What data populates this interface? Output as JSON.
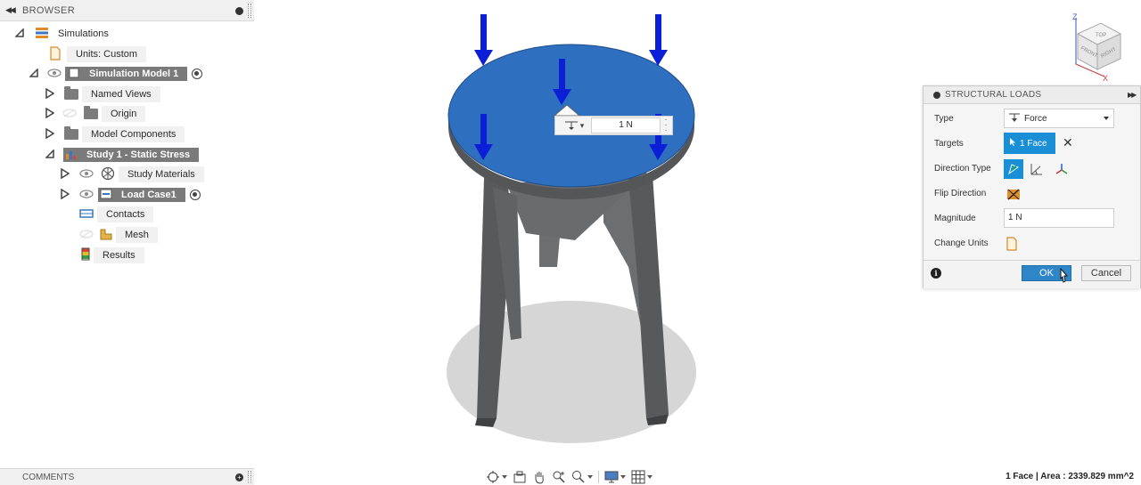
{
  "browser": {
    "title": "BROWSER",
    "tree": [
      {
        "label": "Simulations"
      },
      {
        "label": "Units: Custom"
      },
      {
        "label": "Simulation Model 1"
      },
      {
        "label": "Named Views"
      },
      {
        "label": "Origin"
      },
      {
        "label": "Model Components"
      },
      {
        "label": "Study 1 - Static Stress"
      },
      {
        "label": "Study Materials"
      },
      {
        "label": "Load Case1"
      },
      {
        "label": "Contacts"
      },
      {
        "label": "Mesh"
      },
      {
        "label": "Results"
      }
    ]
  },
  "comments": {
    "title": "COMMENTS"
  },
  "viewport": {
    "load_hud": {
      "value": "1 N"
    },
    "viewcube": {
      "faces": [
        "TOP",
        "FRONT",
        "RIGHT"
      ],
      "axes": [
        "Z",
        "X"
      ]
    }
  },
  "dialog": {
    "title": "STRUCTURAL LOADS",
    "labels": {
      "type": "Type",
      "targets": "Targets",
      "direction_type": "Direction Type",
      "flip_direction": "Flip Direction",
      "magnitude": "Magnitude",
      "change_units": "Change Units"
    },
    "type_value": "Force",
    "targets_value": "1 Face",
    "targets_clear": "✕",
    "magnitude_value": "1 N",
    "ok_label": "OK",
    "cancel_label": "Cancel",
    "info": "i"
  },
  "status_bar": {
    "text": "1 Face | Area : 2339.829 mm^2"
  },
  "colors": {
    "accent": "#1b8fd6",
    "seat": "#2f6fbf",
    "arrow": "#0a1fd6",
    "leg": "#5f6062"
  },
  "icons": [
    "orbit-icon",
    "look-at-icon",
    "pan-icon",
    "zoom-window-icon",
    "zoom-icon",
    "display-settings-icon",
    "grid-icon"
  ]
}
